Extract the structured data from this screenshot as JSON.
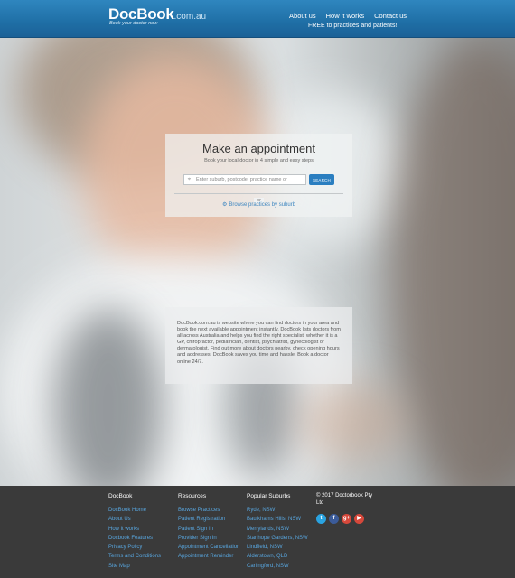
{
  "header": {
    "logo_main": "DocBook",
    "logo_domain": ".com.au",
    "logo_tagline": "Book your doctor now",
    "nav": [
      "About us",
      "How it works",
      "Contact us"
    ],
    "nav_sub": "FREE to practices and patients!"
  },
  "appointment": {
    "title": "Make an appointment",
    "subtitle": "Book your local doctor in 4 simple and easy steps",
    "search_placeholder": "Enter suburb, postcode, practice name or",
    "search_button": "SEARCH",
    "or_label": "or",
    "browse_link": "Browse practices by suburb"
  },
  "info": {
    "text": "DocBook.com.au is website where you can find doctors in your area and book the next available appointment instantly. DocBook lists doctors from all across Australia and helps you find the right specialist, whether it is a GP, chiropractor, pediatrician, dentist, psychiatrist, gynecologist or dermatologist. Find out more about doctors nearby, check opening hours and addresses. DocBook saves you time and hassle. Book a doctor online 24/7."
  },
  "footer": {
    "columns": [
      {
        "title": "DocBook",
        "links": [
          "DocBook Home",
          "About Us",
          "How it works",
          "Docbook Features",
          "Privacy Policy",
          "Terms and Conditions",
          "Site Map"
        ]
      },
      {
        "title": "Resources",
        "links": [
          "Browse Practices",
          "Patient Registration",
          "Patient Sign In",
          "Provider Sign In",
          "Appointment Cancellation",
          "Appointment Reminder"
        ]
      },
      {
        "title": "Popular Suburbs",
        "links": [
          "Ryde, NSW",
          "Baulkhams Hills, NSW",
          "Merrylands, NSW",
          "Stanhope Gardens, NSW",
          "Lindfield, NSW",
          "Alderstown, QLD",
          "Carlingford, NSW"
        ]
      }
    ],
    "copyright": "© 2017 Doctorbook Pty Ltd",
    "social_icons": [
      "twitter-icon",
      "facebook-icon",
      "google-plus-icon",
      "youtube-icon"
    ],
    "social_glyphs": [
      "t",
      "f",
      "g+",
      "▶"
    ]
  },
  "colors": {
    "header_blue": "#1f6fa6",
    "link_blue": "#58a6df",
    "search_button": "#2a7ec0",
    "footer_bg": "#3a3a3a"
  }
}
